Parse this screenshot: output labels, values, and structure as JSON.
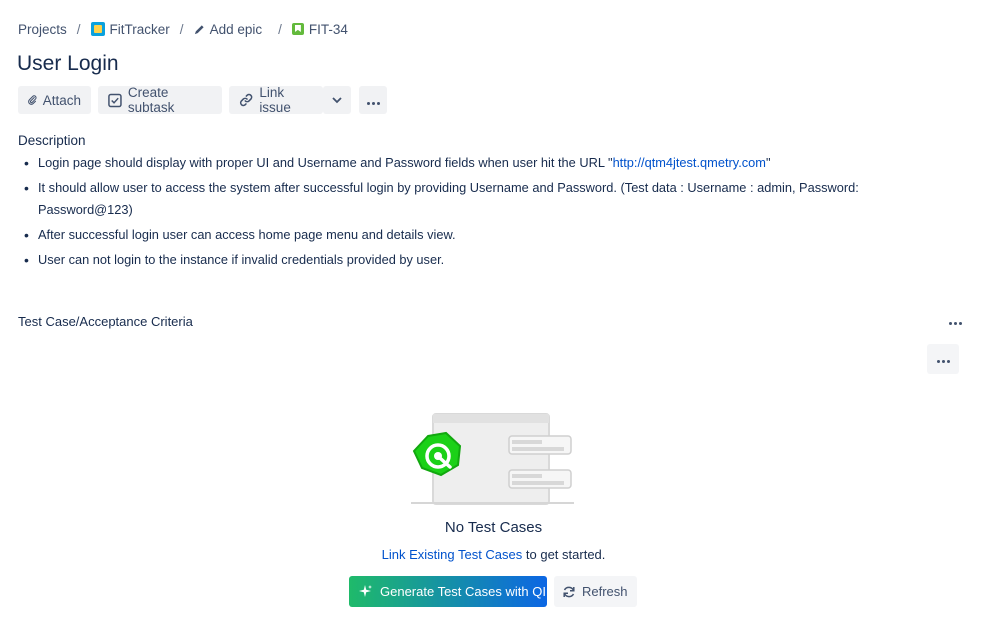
{
  "breadcrumb": {
    "projects": "Projects",
    "project": "FitTracker",
    "epic": "Add epic",
    "issue": "FIT-34"
  },
  "issue": {
    "title": "User Login"
  },
  "toolbar": {
    "attach": "Attach",
    "create_subtask": "Create subtask",
    "link_issue": "Link issue"
  },
  "description": {
    "label": "Description",
    "items": [
      {
        "before": "Login page should display with proper UI and Username and Password fields when user hit the URL \"",
        "link": "http://qtm4jtest.qmetry.com",
        "after": "\""
      },
      {
        "before": "It should allow user to access the system after successful login by providing Username and Password. (Test data : Username : admin, Password: Password@123)"
      },
      {
        "before": "After successful login user can access home page menu and details view."
      },
      {
        "before": "User can not login to the instance if invalid credentials provided by user."
      }
    ]
  },
  "test_cases": {
    "section_title": "Test Case/Acceptance Criteria",
    "empty_title": "No Test Cases",
    "link_text": "Link Existing Test Cases",
    "link_suffix": " to get started.",
    "generate_label": "Generate Test Cases with QI",
    "refresh_label": "Refresh"
  },
  "colors": {
    "link": "#0052cc",
    "story": "#63ba3c",
    "generate_start": "#1fba6a",
    "generate_end": "#0c66e4"
  },
  "icons": [
    "fittracker-project-icon",
    "pencil-icon",
    "story-icon",
    "paperclip-icon",
    "subtask-icon",
    "link-icon",
    "chevron-down-icon",
    "more-icon",
    "sparkle-icon",
    "refresh-icon",
    "qmetry-logo-icon"
  ]
}
